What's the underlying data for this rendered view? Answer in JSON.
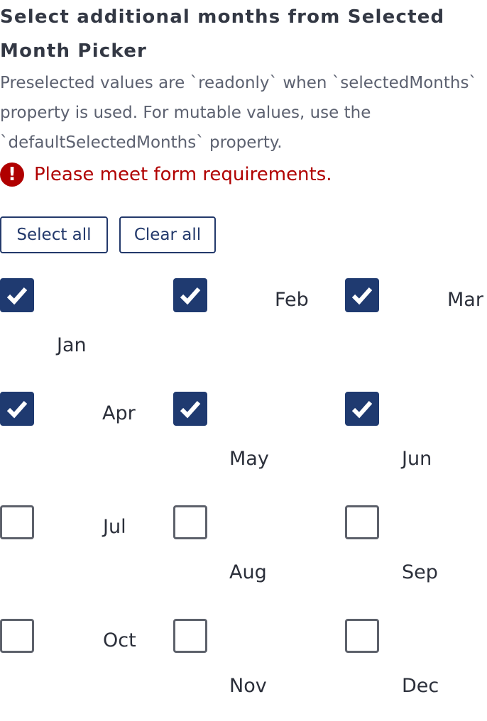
{
  "title": "Select additional months from Selected Month Picker",
  "description": "Preselected values are `readonly` when `selectedMonths` property is used. For mutable values, use the `defaultSelectedMonths` property.",
  "error": {
    "icon": "exclamation-icon",
    "message": "Please meet form requirements.",
    "color": "#b00000"
  },
  "buttons": {
    "select_all": "Select all",
    "clear_all": "Clear all"
  },
  "accent_color": "#1f3a70",
  "months": [
    {
      "label": "Jan",
      "checked": true
    },
    {
      "label": "Feb",
      "checked": true
    },
    {
      "label": "Mar",
      "checked": true
    },
    {
      "label": "Apr",
      "checked": true
    },
    {
      "label": "May",
      "checked": true
    },
    {
      "label": "Jun",
      "checked": true
    },
    {
      "label": "Jul",
      "checked": false
    },
    {
      "label": "Aug",
      "checked": false
    },
    {
      "label": "Sep",
      "checked": false
    },
    {
      "label": "Oct",
      "checked": false
    },
    {
      "label": "Nov",
      "checked": false
    },
    {
      "label": "Dec",
      "checked": false
    }
  ]
}
